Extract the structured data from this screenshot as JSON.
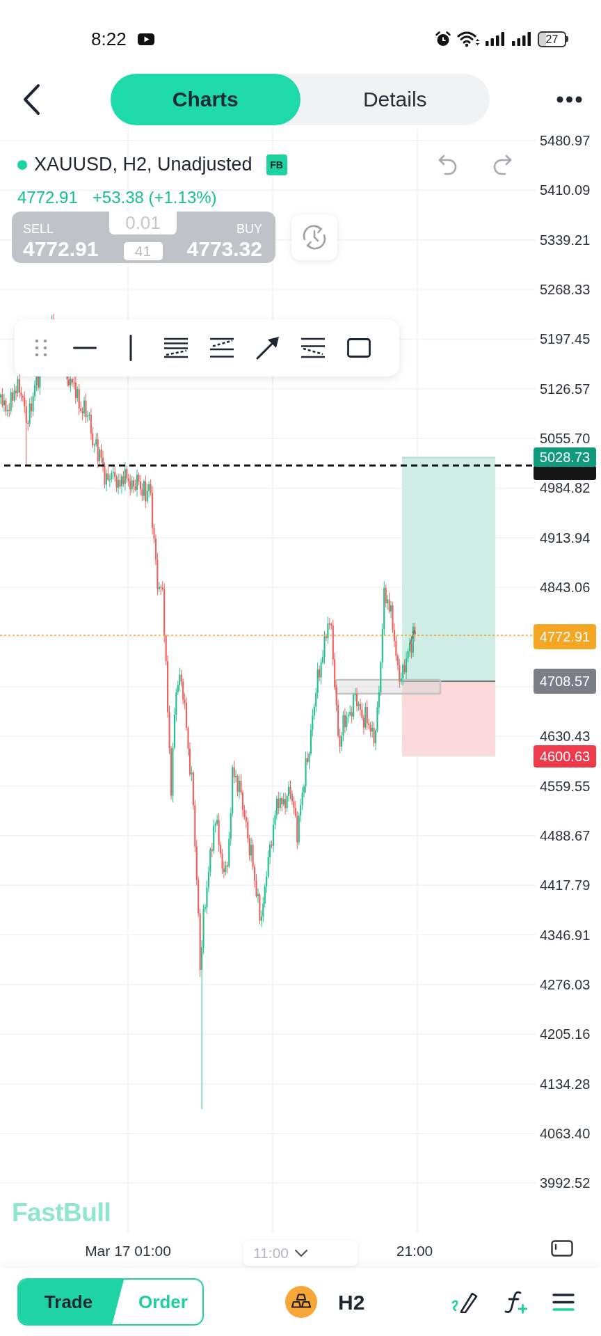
{
  "status_bar": {
    "time": "8:22",
    "battery": "27"
  },
  "header": {
    "tabs": [
      {
        "label": "Charts",
        "selected": true
      },
      {
        "label": "Details",
        "selected": false
      }
    ]
  },
  "instrument": {
    "title": "XAUUSD, H2, Unadjusted",
    "badge": "FB",
    "price": "4772.91",
    "change": "+53.38 (+1.13%)"
  },
  "quote_panel": {
    "sell_label": "SELL",
    "sell_price": "4772.91",
    "lot": "0.01",
    "spread": "41",
    "buy_label": "BUY",
    "buy_price": "4773.32"
  },
  "price_axis": {
    "labels": [
      "5480.97",
      "5410.09",
      "5339.21",
      "5268.33",
      "5197.45",
      "5126.57",
      "5055.70",
      "4984.82",
      "4913.94",
      "4843.06",
      "4630.43",
      "4559.55",
      "4488.67",
      "4417.79",
      "4346.91",
      "4276.03",
      "4205.16",
      "4134.28",
      "4063.40",
      "3992.52"
    ]
  },
  "price_tags": [
    {
      "kind": "take_profit",
      "label": "5028.73",
      "color": "#0f9a7b"
    },
    {
      "kind": "last_price",
      "label": "4772.91",
      "color": "#f5a623"
    },
    {
      "kind": "entry",
      "label": "4708.57",
      "color": "#7b7e87"
    },
    {
      "kind": "stop_loss",
      "label": "4600.63",
      "color": "#ef3a4c"
    }
  ],
  "chart_logo": "FastBull",
  "time_axis": {
    "labels": [
      {
        "kind": "label",
        "text": "Mar 17 01:00"
      },
      {
        "kind": "dropdown",
        "text": "11:00"
      },
      {
        "kind": "label",
        "text": "21:00"
      }
    ]
  },
  "bottom_bar": {
    "modes": [
      {
        "label": "Trade",
        "selected": true
      },
      {
        "label": "Order",
        "selected": false
      }
    ],
    "timeframe": "H2"
  }
}
